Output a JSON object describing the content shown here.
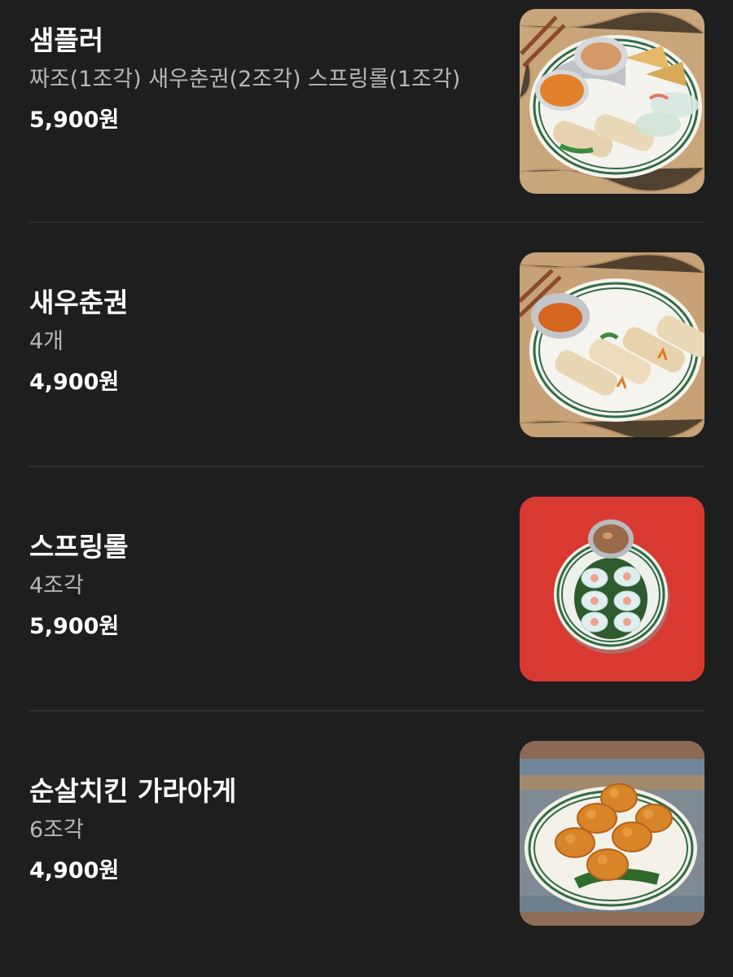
{
  "menu": {
    "items": [
      {
        "name": "샘플러",
        "description": "짜조(1조각) 새우춘권(2조각) 스프링롤(1조각)",
        "price": "5,900원",
        "image": "sampler-platter-photo"
      },
      {
        "name": "새우춘권",
        "description": "4개",
        "price": "4,900원",
        "image": "shrimp-spring-roll-photo"
      },
      {
        "name": "스프링롤",
        "description": "4조각",
        "price": "5,900원",
        "image": "fresh-spring-roll-photo"
      },
      {
        "name": "순살치킨 가라아게",
        "description": "6조각",
        "price": "4,900원",
        "image": "boneless-chicken-karaage-photo"
      }
    ]
  },
  "colors": {
    "background": "#1e1e1f",
    "title": "#ffffff",
    "description": "#b6b6b8",
    "divider": "#2e2e30"
  }
}
